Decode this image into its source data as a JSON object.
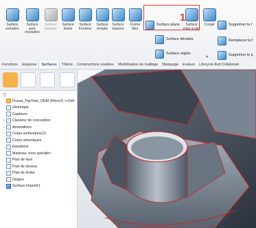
{
  "ribbon": {
    "tools": [
      {
        "label": "Surface extrudée",
        "icon": "extruded-surface-icon",
        "enabled": true
      },
      {
        "label": "Surface avec révolution",
        "icon": "revolved-surface-icon",
        "enabled": true
      },
      {
        "label": "Surface balayée",
        "icon": "swept-surface-icon",
        "enabled": false
      },
      {
        "label": "Surface lissée",
        "icon": "lofted-surface-icon",
        "enabled": true
      },
      {
        "label": "Surface frontière",
        "icon": "boundary-surface-icon",
        "enabled": true
      },
      {
        "label": "Surface remplie",
        "icon": "filled-surface-icon",
        "enabled": true
      },
      {
        "label": "Surface équerre",
        "icon": "ruled-surface-icon",
        "enabled": true
      },
      {
        "label": "Forme libre",
        "icon": "freeform-icon",
        "enabled": true
      }
    ],
    "surface_plane": "Surface plane",
    "surface_decalee": "Surface décalée",
    "surface_reglee": "Surface réglée",
    "surface_mise_plat": "Surface mise à plat",
    "conge": "Congé",
    "supprimer_face": "Supprimer la f",
    "remplacer_face": "Remplacer la f",
    "supprimer_poignee": "Supprimer le p",
    "callout_number": "1"
  },
  "tabs": [
    "Fonctions",
    "Esquisse",
    "Surfaces",
    "Tôlerie",
    "Constructions soudées",
    "Modélisation de maillage",
    "Marquage",
    "Evaluer",
    "Lifecycle And Collaborati"
  ],
  "active_tab": "Surfaces",
  "tree": [
    {
      "label": "Ducati_TopYoke_OEM (Pièce2) <<Déf",
      "type": "root",
      "expand": ""
    },
    {
      "label": "Historique",
      "type": "item",
      "expand": ""
    },
    {
      "label": "Capteurs",
      "type": "item",
      "expand": ""
    },
    {
      "label": "Classeur de conception",
      "type": "item",
      "expand": "›"
    },
    {
      "label": "Annotations",
      "type": "item",
      "expand": "›"
    },
    {
      "label": "Corps surfaciques(1)",
      "type": "item",
      "expand": "›"
    },
    {
      "label": "Corps volumiques",
      "type": "item",
      "expand": ""
    },
    {
      "label": "Equations",
      "type": "item",
      "expand": ""
    },
    {
      "label": "Matériau <non spécifié>",
      "type": "item",
      "expand": ""
    },
    {
      "label": "Plan de face",
      "type": "item",
      "expand": ""
    },
    {
      "label": "Plan de dessus",
      "type": "item",
      "expand": ""
    },
    {
      "label": "Plan de droite",
      "type": "item",
      "expand": ""
    },
    {
      "label": "Origine",
      "type": "item",
      "expand": ""
    },
    {
      "label": "Surface-Importé1",
      "type": "surf",
      "expand": ""
    }
  ],
  "colors": {
    "accent": "#1f4e8c",
    "highlight": "#e53935",
    "model_edge": "#c62828"
  }
}
